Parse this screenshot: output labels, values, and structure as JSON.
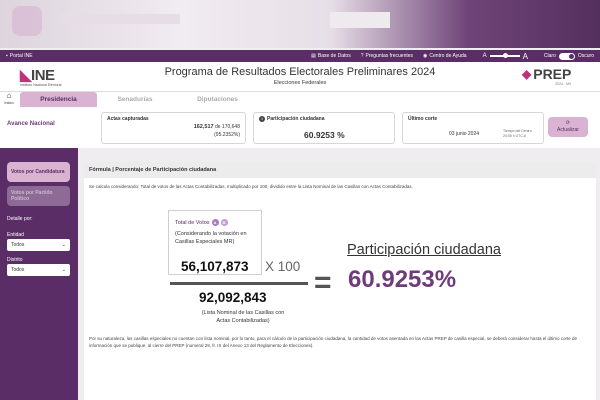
{
  "utility": {
    "portal": "Portal INE",
    "links": [
      "Base de Datos",
      "Preguntas frecuentes",
      "Centro de Ayuda"
    ],
    "font_small": "A",
    "font_large": "A",
    "mode_light": "Claro",
    "mode_dark": "Oscuro"
  },
  "header": {
    "ine_logo": "INE",
    "ine_sub": "Instituto Nacional Electoral",
    "title": "Programa de Resultados Electorales Preliminares 2024",
    "subtitle": "Elecciones Federales",
    "prep_logo": "PREP",
    "prep_sub": "2024 · MX"
  },
  "nav": {
    "home": "Inicio",
    "tabs": [
      "Presidencia",
      "Senadurías",
      "Diputaciones"
    ]
  },
  "avance": {
    "label": "Avance Nacional",
    "actas_title": "Actas capturadas",
    "actas_count": "162,517",
    "actas_total": "de 170,648",
    "actas_pct": "(95.2352%)",
    "participacion_title": "Participación ciudadana",
    "participacion_value": "60.9253 %",
    "corte_title": "Último corte",
    "corte_date": "03 junio 2024",
    "corte_tz_1": "Tiempo del Centro",
    "corte_tz_2": "20:05 h UTC-6",
    "update_button": "Actualizar"
  },
  "sidebar": {
    "btn_candidatura": "Votos por Candidatura",
    "btn_partido": "Votos por Partido Político",
    "detalle": "Detalle por:",
    "entidad_label": "Entidad",
    "entidad_value": "Todos",
    "distrito_label": "Distrito",
    "distrito_value": "Todos"
  },
  "formula": {
    "title": "Fórmula | Porcentaje de Participación ciudadana",
    "description": "Se calcula considerando: Total de votos de las Actas Contabilizadas, multiplicado por 100, dividido entre la Lista Nominal de las Casillas con Actas Contabilizadas.",
    "total_votos": "Total de Votos",
    "pill_a": "A",
    "pill_b": "B",
    "considerando": "(Considerando la votación en Casillas Especiales MR)",
    "numerator": "56,107,873",
    "times": "X 100",
    "denominator": "92,092,843",
    "lista_nominal": "(Lista Nominal de las Casillas con Actas Contabilizadas)",
    "equals": "=",
    "result_title": "Participación ciudadana",
    "result_value": "60.9253%",
    "note": "Por su naturaleza, las casillas especiales no cuentan con lista nominal, por lo tanto, para el cálculo de la participación ciudadana, la cantidad de votos asentada en las Actas PREP de casilla especial, se deberá considerar hasta el último corte de información que se publique, al cierre del PREP (numeral 29, fr. IX del Anexo 13 del Reglamento de Elecciones)."
  }
}
